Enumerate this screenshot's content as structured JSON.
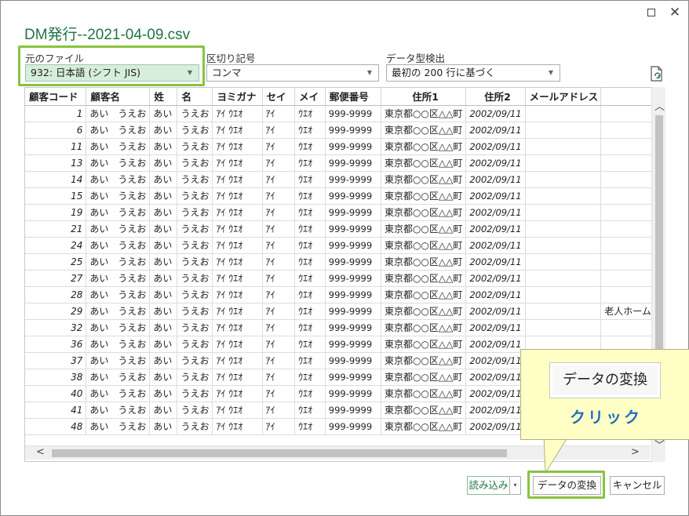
{
  "window": {
    "title": "DM発行--2021-04-09.csv",
    "close_glyph": "✕"
  },
  "options": {
    "origin_label": "元のファイル",
    "origin_value": "932: 日本語 (シフト JIS)",
    "delimiter_label": "区切り記号",
    "delimiter_value": "コンマ",
    "detect_label": "データ型検出",
    "detect_value": "最初の 200 行に基づく"
  },
  "table": {
    "columns": [
      "顧客コード",
      "顧客名",
      "姓",
      "名",
      "ヨミガナ",
      "セイ",
      "メイ",
      "郵便番号",
      "住所1",
      "住所2",
      "メールアドレス",
      ""
    ],
    "rows": [
      [
        "1",
        "あい　うえお",
        "あい",
        "うえお",
        "ｱｲ ｳｴｵ",
        "ｱｲ",
        "ｳｴｵ",
        "999-9999",
        "東京都○○区△△町",
        "2002/09/11",
        "",
        ""
      ],
      [
        "6",
        "あい　うえお",
        "あい",
        "うえお",
        "ｱｲ ｳｴｵ",
        "ｱｲ",
        "ｳｴｵ",
        "999-9999",
        "東京都○○区△△町",
        "2002/09/11",
        "",
        ""
      ],
      [
        "11",
        "あい　うえお",
        "あい",
        "うえお",
        "ｱｲ ｳｴｵ",
        "ｱｲ",
        "ｳｴｵ",
        "999-9999",
        "東京都○○区△△町",
        "2002/09/11",
        "",
        ""
      ],
      [
        "13",
        "あい　うえお",
        "あい",
        "うえお",
        "ｱｲ ｳｴｵ",
        "ｱｲ",
        "ｳｴｵ",
        "999-9999",
        "東京都○○区△△町",
        "2002/09/11",
        "",
        ""
      ],
      [
        "14",
        "あい　うえお",
        "あい",
        "うえお",
        "ｱｲ ｳｴｵ",
        "ｱｲ",
        "ｳｴｵ",
        "999-9999",
        "東京都○○区△△町",
        "2002/09/11",
        "",
        ""
      ],
      [
        "15",
        "あい　うえお",
        "あい",
        "うえお",
        "ｱｲ ｳｴｵ",
        "ｱｲ",
        "ｳｴｵ",
        "999-9999",
        "東京都○○区△△町",
        "2002/09/11",
        "",
        ""
      ],
      [
        "19",
        "あい　うえお",
        "あい",
        "うえお",
        "ｱｲ ｳｴｵ",
        "ｱｲ",
        "ｳｴｵ",
        "999-9999",
        "東京都○○区△△町",
        "2002/09/11",
        "",
        ""
      ],
      [
        "21",
        "あい　うえお",
        "あい",
        "うえお",
        "ｱｲ ｳｴｵ",
        "ｱｲ",
        "ｳｴｵ",
        "999-9999",
        "東京都○○区△△町",
        "2002/09/11",
        "",
        ""
      ],
      [
        "24",
        "あい　うえお",
        "あい",
        "うえお",
        "ｱｲ ｳｴｵ",
        "ｱｲ",
        "ｳｴｵ",
        "999-9999",
        "東京都○○区△△町",
        "2002/09/11",
        "",
        ""
      ],
      [
        "25",
        "あい　うえお",
        "あい",
        "うえお",
        "ｱｲ ｳｴｵ",
        "ｱｲ",
        "ｳｴｵ",
        "999-9999",
        "東京都○○区△△町",
        "2002/09/11",
        "",
        ""
      ],
      [
        "27",
        "あい　うえお",
        "あい",
        "うえお",
        "ｱｲ ｳｴｵ",
        "ｱｲ",
        "ｳｴｵ",
        "999-9999",
        "東京都○○区△△町",
        "2002/09/11",
        "",
        ""
      ],
      [
        "28",
        "あい　うえお",
        "あい",
        "うえお",
        "ｱｲ ｳｴｵ",
        "ｱｲ",
        "ｳｴｵ",
        "999-9999",
        "東京都○○区△△町",
        "2002/09/11",
        "",
        ""
      ],
      [
        "29",
        "あい　うえお",
        "あい",
        "うえお",
        "ｱｲ ｳｴｵ",
        "ｱｲ",
        "ｳｴｵ",
        "999-9999",
        "東京都○○区△△町",
        "2002/09/11",
        "",
        "老人ホーム介"
      ],
      [
        "32",
        "あい　うえお",
        "あい",
        "うえお",
        "ｱｲ ｳｴｵ",
        "ｱｲ",
        "ｳｴｵ",
        "999-9999",
        "東京都○○区△△町",
        "2002/09/11",
        "",
        ""
      ],
      [
        "36",
        "あい　うえお",
        "あい",
        "うえお",
        "ｱｲ ｳｴｵ",
        "ｱｲ",
        "ｳｴｵ",
        "999-9999",
        "東京都○○区△△町",
        "2002/09/11",
        "",
        ""
      ],
      [
        "37",
        "あい　うえお",
        "あい",
        "うえお",
        "ｱｲ ｳｴｵ",
        "ｱｲ",
        "ｳｴｵ",
        "999-9999",
        "東京都○○区△△町",
        "2002/09/11",
        "",
        ""
      ],
      [
        "38",
        "あい　うえお",
        "あい",
        "うえお",
        "ｱｲ ｳｴｵ",
        "ｱｲ",
        "ｳｴｵ",
        "999-9999",
        "東京都○○区△△町",
        "2002/09/11",
        "",
        ""
      ],
      [
        "40",
        "あい　うえお",
        "あい",
        "うえお",
        "ｱｲ ｳｴｵ",
        "ｱｲ",
        "ｳｴｵ",
        "999-9999",
        "東京都○○区△△町",
        "2002/09/11",
        "",
        ""
      ],
      [
        "41",
        "あい　うえお",
        "あい",
        "うえお",
        "ｱｲ ｳｴｵ",
        "ｱｲ",
        "ｳｴｵ",
        "999-9999",
        "東京都○○区△△町",
        "2002/09/11",
        "",
        ""
      ],
      [
        "48",
        "あい　うえお",
        "あい",
        "うえお",
        "ｱｲ ｳｴｵ",
        "ｱｲ",
        "ｳｴｵ",
        "999-9999",
        "東京都○○区△△町",
        "2002/09/11",
        "",
        ""
      ]
    ]
  },
  "buttons": {
    "load": "読み込み",
    "load_arrow": "▾",
    "convert": "データの変換",
    "cancel": "キャンセル"
  },
  "callout": {
    "button_label": "データの変換",
    "text": "クリック"
  },
  "colors": {
    "title": "#217346",
    "highlight": "#86c440",
    "callout_bg": "#fffec4",
    "callout_text": "#1f6fc5"
  },
  "icons": {
    "refresh": "refresh-preview-icon",
    "maximize": "maximize-icon",
    "close": "close-icon"
  }
}
